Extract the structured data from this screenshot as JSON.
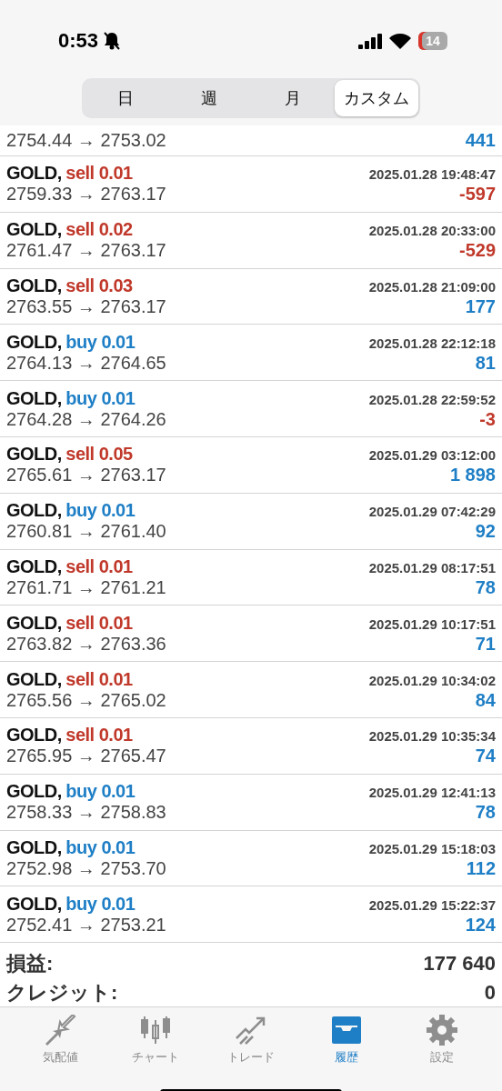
{
  "status_bar": {
    "time": "0:53",
    "silent": true,
    "battery": "14"
  },
  "period_tabs": [
    {
      "label": "日",
      "selected": false
    },
    {
      "label": "週",
      "selected": false
    },
    {
      "label": "月",
      "selected": false
    },
    {
      "label": "カスタム",
      "selected": true
    }
  ],
  "partial_deal": {
    "prices": "2754.44 → 2753.02",
    "profit": {
      "value": "441",
      "kind": "profit"
    }
  },
  "deals": [
    {
      "symbol": "GOLD,",
      "order": "sell 0.01",
      "kind": "sell",
      "time": "2025.01.28 19:48:47",
      "prices": "2759.33 → 2763.17",
      "profit": {
        "value": "-597",
        "kind": "loss"
      }
    },
    {
      "symbol": "GOLD,",
      "order": "sell 0.02",
      "kind": "sell",
      "time": "2025.01.28 20:33:00",
      "prices": "2761.47 → 2763.17",
      "profit": {
        "value": "-529",
        "kind": "loss"
      }
    },
    {
      "symbol": "GOLD,",
      "order": "sell 0.03",
      "kind": "sell",
      "time": "2025.01.28 21:09:00",
      "prices": "2763.55 → 2763.17",
      "profit": {
        "value": "177",
        "kind": "profit"
      }
    },
    {
      "symbol": "GOLD,",
      "order": "buy 0.01",
      "kind": "buy",
      "time": "2025.01.28 22:12:18",
      "prices": "2764.13 → 2764.65",
      "profit": {
        "value": "81",
        "kind": "profit"
      }
    },
    {
      "symbol": "GOLD,",
      "order": "buy 0.01",
      "kind": "buy",
      "time": "2025.01.28 22:59:52",
      "prices": "2764.28 → 2764.26",
      "profit": {
        "value": "-3",
        "kind": "loss"
      }
    },
    {
      "symbol": "GOLD,",
      "order": "sell 0.05",
      "kind": "sell",
      "time": "2025.01.29 03:12:00",
      "prices": "2765.61 → 2763.17",
      "profit": {
        "value": "1 898",
        "kind": "profit"
      }
    },
    {
      "symbol": "GOLD,",
      "order": "buy 0.01",
      "kind": "buy",
      "time": "2025.01.29 07:42:29",
      "prices": "2760.81 → 2761.40",
      "profit": {
        "value": "92",
        "kind": "profit"
      }
    },
    {
      "symbol": "GOLD,",
      "order": "sell 0.01",
      "kind": "sell",
      "time": "2025.01.29 08:17:51",
      "prices": "2761.71 → 2761.21",
      "profit": {
        "value": "78",
        "kind": "profit"
      }
    },
    {
      "symbol": "GOLD,",
      "order": "sell 0.01",
      "kind": "sell",
      "time": "2025.01.29 10:17:51",
      "prices": "2763.82 → 2763.36",
      "profit": {
        "value": "71",
        "kind": "profit"
      }
    },
    {
      "symbol": "GOLD,",
      "order": "sell 0.01",
      "kind": "sell",
      "time": "2025.01.29 10:34:02",
      "prices": "2765.56 → 2765.02",
      "profit": {
        "value": "84",
        "kind": "profit"
      }
    },
    {
      "symbol": "GOLD,",
      "order": "sell 0.01",
      "kind": "sell",
      "time": "2025.01.29 10:35:34",
      "prices": "2765.95 → 2765.47",
      "profit": {
        "value": "74",
        "kind": "profit"
      }
    },
    {
      "symbol": "GOLD,",
      "order": "buy 0.01",
      "kind": "buy",
      "time": "2025.01.29 12:41:13",
      "prices": "2758.33 → 2758.83",
      "profit": {
        "value": "78",
        "kind": "profit"
      }
    },
    {
      "symbol": "GOLD,",
      "order": "buy 0.01",
      "kind": "buy",
      "time": "2025.01.29 15:18:03",
      "prices": "2752.98 → 2753.70",
      "profit": {
        "value": "112",
        "kind": "profit"
      }
    },
    {
      "symbol": "GOLD,",
      "order": "buy 0.01",
      "kind": "buy",
      "time": "2025.01.29 15:22:37",
      "prices": "2752.41 → 2753.21",
      "profit": {
        "value": "124",
        "kind": "profit"
      }
    }
  ],
  "summary": [
    {
      "label": "損益:",
      "value": "177 640"
    },
    {
      "label": "クレジット:",
      "value": "0"
    }
  ],
  "tab_bar": [
    {
      "label": "気配値",
      "selected": false
    },
    {
      "label": "チャート",
      "selected": false
    },
    {
      "label": "トレード",
      "selected": false
    },
    {
      "label": "履歴",
      "selected": true
    },
    {
      "label": "設定",
      "selected": false
    }
  ]
}
